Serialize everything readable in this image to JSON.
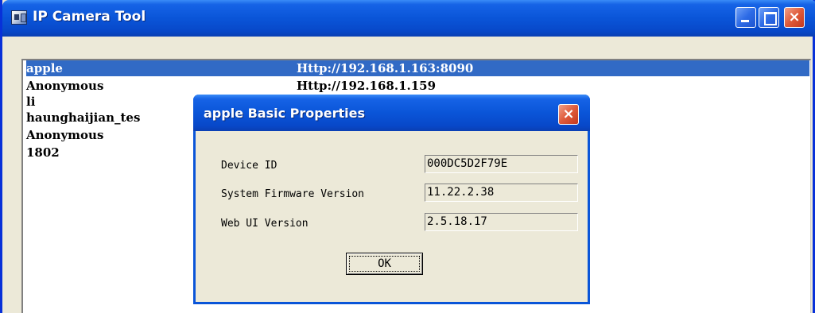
{
  "window": {
    "title": "IP Camera Tool",
    "close_glyph": "×"
  },
  "devices": [
    {
      "name": "apple",
      "address": "Http://192.168.1.163:8090",
      "selected": true
    },
    {
      "name": "Anonymous",
      "address": "Http://192.168.1.159",
      "selected": false
    },
    {
      "name": "li",
      "address": "",
      "selected": false
    },
    {
      "name": "haunghaijian_tes",
      "address": "",
      "selected": false
    },
    {
      "name": "Anonymous",
      "address": "",
      "selected": false
    },
    {
      "name": "1802",
      "address": "",
      "selected": false
    }
  ],
  "dialog": {
    "title": "apple Basic Properties",
    "close_glyph": "×",
    "properties": [
      {
        "label": "Device ID",
        "value": "000DC5D2F79E"
      },
      {
        "label": "System Firmware Version",
        "value": "11.22.2.38"
      },
      {
        "label": "Web UI Version",
        "value": "2.5.18.17"
      }
    ],
    "ok_label": "OK"
  },
  "icons": {
    "app": "camera-app-icon",
    "minimize": "minimize-icon",
    "maximize": "maximize-icon",
    "close": "close-icon"
  },
  "colors": {
    "titlebar": "#0a55d8",
    "selection": "#316ac5",
    "close_button": "#df5a3a",
    "window_face": "#ece9d8"
  }
}
